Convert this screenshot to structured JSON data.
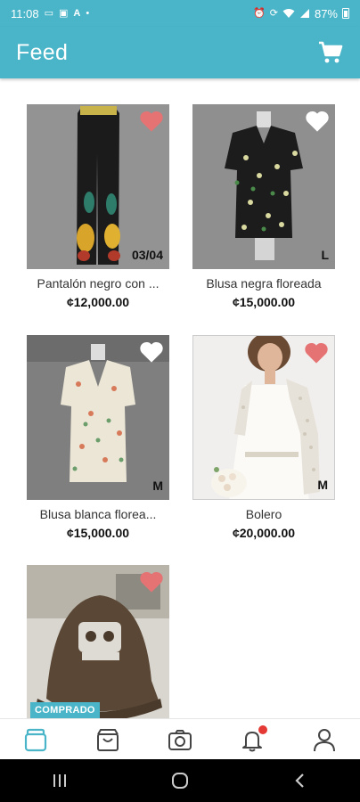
{
  "status_bar": {
    "time": "11:08",
    "battery": "87%",
    "left_icons": [
      "laptop-icon",
      "image-icon",
      "a-icon",
      "dot-icon"
    ],
    "right_icons": [
      "alarm-icon",
      "sync-icon",
      "wifi-icon",
      "signal-icon",
      "battery-icon"
    ]
  },
  "header": {
    "title": "Feed",
    "cart_icon": "cart-icon"
  },
  "colors": {
    "primary": "#4ab5c8",
    "heart_liked": "#e57373",
    "heart_empty": "#ffffff",
    "notification": "#e53935"
  },
  "products": [
    {
      "name": "Pantalón negro con ...",
      "price": "¢12,000.00",
      "size": "03/04",
      "liked": true,
      "sold": false,
      "image": "black floral pants on mannequin"
    },
    {
      "name": "Blusa negra floreada",
      "price": "¢15,000.00",
      "size": "L",
      "liked": false,
      "sold": false,
      "image": "black floral blouse on mannequin"
    },
    {
      "name": "Blusa blanca florea...",
      "price": "¢15,000.00",
      "size": "M",
      "liked": false,
      "sold": false,
      "image": "white floral blouse on mannequin"
    },
    {
      "name": "Bolero",
      "price": "¢20,000.00",
      "size": "M",
      "liked": true,
      "sold": false,
      "image": "bride wearing lace bolero"
    },
    {
      "name": "",
      "price": "",
      "size": "",
      "liked": true,
      "sold": true,
      "sold_label": "COMPRADO",
      "image": "brown Grumpy cap"
    }
  ],
  "bottom_nav": [
    {
      "icon": "feed-icon",
      "active": true
    },
    {
      "icon": "shopping-bag-icon",
      "active": false
    },
    {
      "icon": "camera-icon",
      "active": false
    },
    {
      "icon": "bell-icon",
      "active": false,
      "badge": true
    },
    {
      "icon": "profile-icon",
      "active": false
    }
  ],
  "system_nav": [
    "recents-icon",
    "home-icon",
    "back-icon"
  ]
}
